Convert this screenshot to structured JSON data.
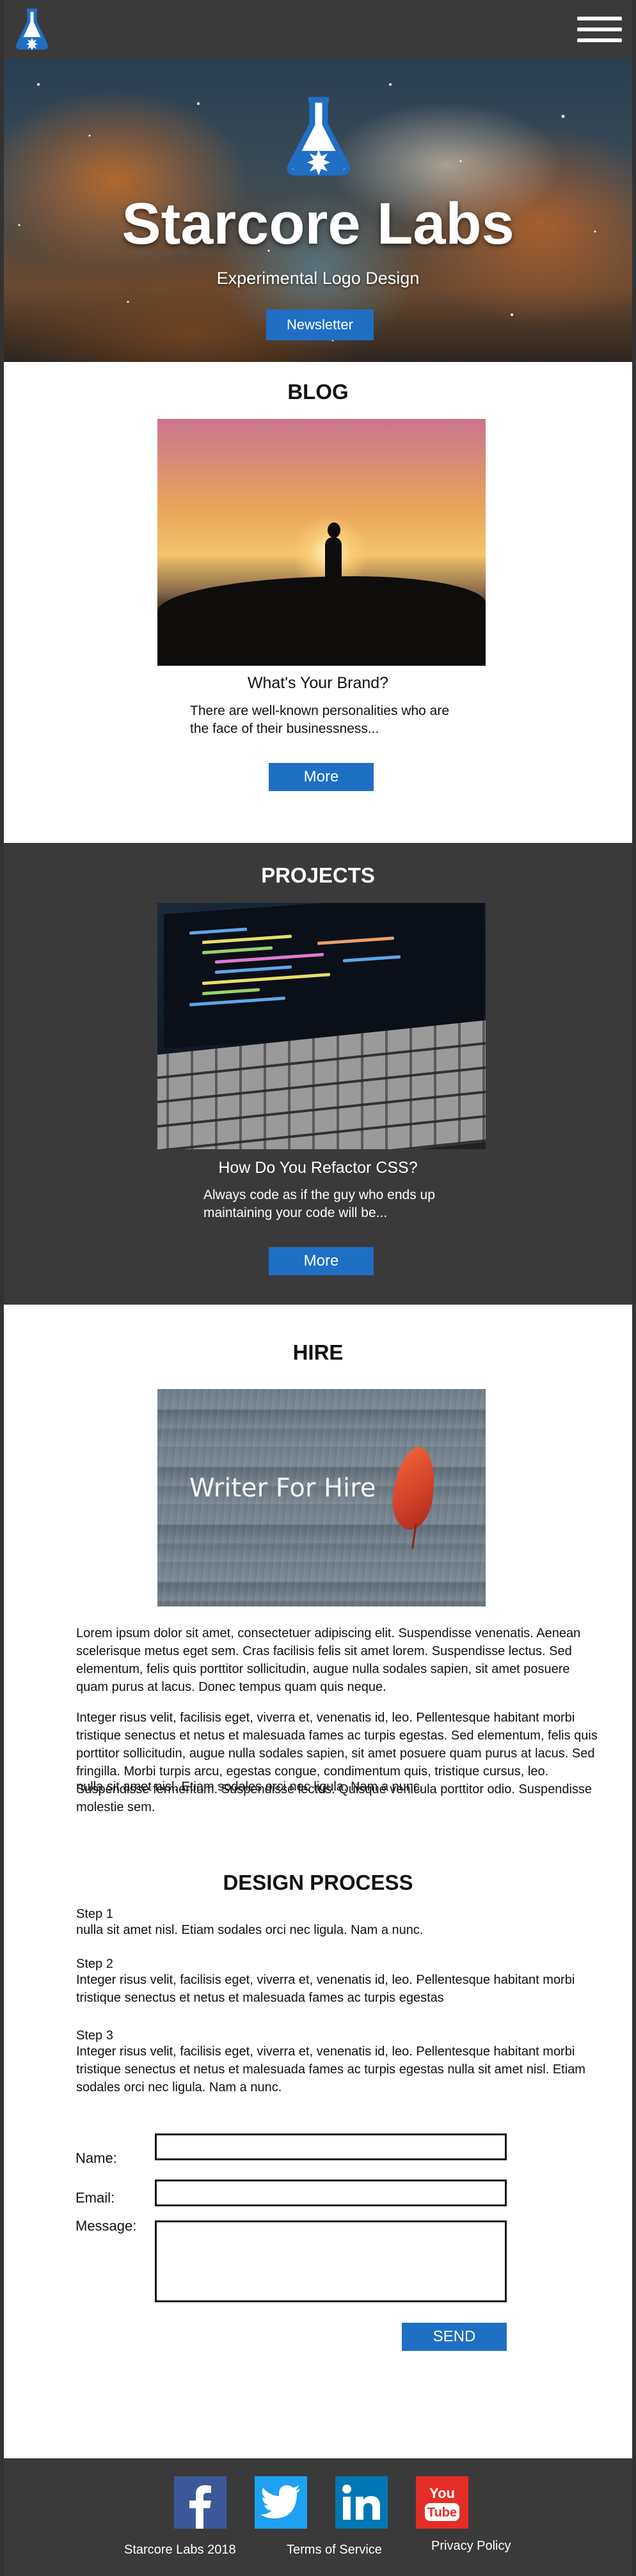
{
  "hero": {
    "title": "Starcore Labs",
    "subtitle": "Experimental Logo Design",
    "newsletter_label": "Newsletter"
  },
  "blog": {
    "heading": "BLOG",
    "post_title": "What's Your Brand?",
    "excerpt": "There are well-known personalities who are the face of their businessness...",
    "more_label": "More"
  },
  "projects": {
    "heading": "PROJECTS",
    "post_title": "How Do You Refactor CSS?",
    "excerpt": "Always code as if the guy who ends up maintaining your code will be...",
    "more_label": "More"
  },
  "hire": {
    "heading": "HIRE",
    "image_text": "Writer For Hire",
    "paragraphs": [
      "Lorem ipsum dolor sit amet, consectetuer adipiscing elit. Suspendisse venenatis. Aenean scelerisque metus eget sem. Cras facilisis felis sit amet lorem. Suspendisse lectus. Sed elementum, felis quis porttitor sollicitudin, augue nulla sodales sapien, sit amet posuere quam purus at lacus. Donec tempus quam quis neque.",
      "Integer risus velit, facilisis eget, viverra et, venenatis id, leo. Pellentesque habitant morbi tristique senectus et netus et malesuada fames ac turpis egestas. Sed elementum, felis quis porttitor sollicitudin, augue nulla sodales sapien, sit amet posuere quam purus at lacus. Sed fringilla. Morbi turpis arcu, egestas congue, condimentum quis, tristique cursus, leo. Suspendisse fermentum. Suspendisse lectus. Quisque vehicula porttitor odio. Suspendisse molestie sem.",
      "nulla sit amet nisl. Etiam sodales orci nec ligula. Nam a nunc."
    ]
  },
  "design_process": {
    "heading": "DESIGN PROCESS",
    "steps": [
      {
        "label": "Step 1",
        "text": "nulla sit amet nisl. Etiam sodales orci nec ligula. Nam a nunc."
      },
      {
        "label": "Step 2",
        "text": "Integer risus velit, facilisis eget, viverra et, venenatis id, leo. Pellentesque habitant morbi tristique senectus et netus et malesuada fames ac turpis egestas"
      },
      {
        "label": "Step 3",
        "text": "Integer risus velit, facilisis eget, viverra et, venenatis id, leo. Pellentesque habitant morbi tristique senectus et netus et malesuada fames ac turpis egestas nulla sit amet nisl. Etiam sodales orci nec ligula. Nam a nunc."
      }
    ]
  },
  "contact_form": {
    "name_label": "Name:",
    "email_label": "Email:",
    "message_label": "Message:",
    "name_value": "",
    "email_value": "",
    "message_value": "",
    "send_label": "SEND"
  },
  "footer": {
    "social": [
      {
        "name": "facebook-icon",
        "glyph": "f"
      },
      {
        "name": "twitter-icon",
        "glyph": ""
      },
      {
        "name": "linkedin-icon",
        "glyph": "in"
      },
      {
        "name": "youtube-icon",
        "glyph_top": "You",
        "glyph_bottom": "Tube"
      }
    ],
    "copyright": "Starcore Labs 2018",
    "terms": "Terms of Service",
    "privacy": "Privacy Policy"
  },
  "colors": {
    "dark_bg": "#3a3a3a",
    "accent_blue": "#1f6fc5",
    "logo_blue": "#1f6fc5"
  }
}
